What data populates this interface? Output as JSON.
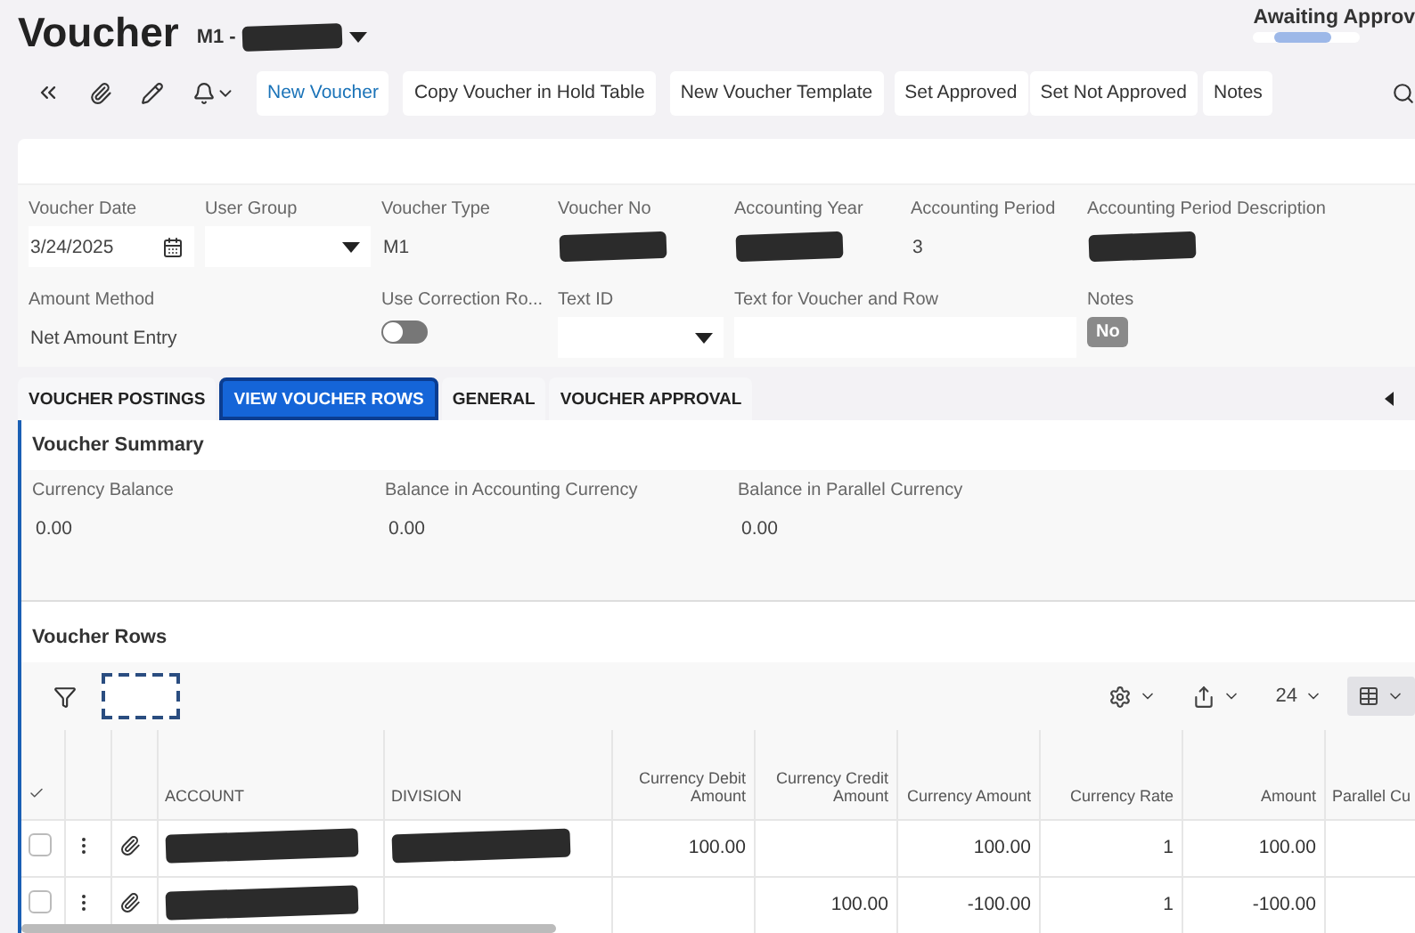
{
  "header": {
    "title": "Voucher",
    "subtitle": "M1 -",
    "status": "Awaiting Approv"
  },
  "toolbar": {
    "buttons": [
      {
        "label": "New Voucher",
        "kind": "primary"
      },
      {
        "label": "Copy Voucher in Hold Table",
        "kind": "plain"
      },
      {
        "label": "New Voucher Template",
        "kind": "plain"
      },
      {
        "label": "Set Approved",
        "kind": "grouped"
      },
      {
        "label": "Set Not Approved",
        "kind": "grouped"
      },
      {
        "label": "Notes",
        "kind": "plain"
      }
    ]
  },
  "field_rows": [
    {
      "fields": [
        {
          "label": "Voucher Date",
          "value": "3/24/2025",
          "kind": "date"
        },
        {
          "label": "User Group",
          "kind": "select"
        },
        {
          "label": "Voucher Type",
          "value": "M1",
          "kind": "text"
        },
        {
          "label": "Voucher No",
          "kind": "redacted"
        },
        {
          "label": "Accounting Year",
          "kind": "redacted"
        },
        {
          "label": "Accounting Period",
          "value": "3",
          "kind": "text"
        },
        {
          "label": "Accounting Period Description",
          "kind": "redacted"
        }
      ]
    },
    {
      "fields": [
        {
          "label": "Amount Method",
          "value": "Net Amount Entry",
          "kind": "text",
          "wide": true
        },
        {
          "label": "Use Correction Ro...",
          "kind": "toggle",
          "on": false
        },
        {
          "label": "Text ID",
          "kind": "select"
        },
        {
          "label": "Text for Voucher and Row",
          "kind": "input",
          "wide": true
        },
        {
          "label": "Notes",
          "value": "No",
          "kind": "badge"
        }
      ]
    }
  ],
  "tabs": [
    {
      "label": "VOUCHER POSTINGS",
      "selected": false
    },
    {
      "label": "VIEW VOUCHER ROWS",
      "selected": true
    },
    {
      "label": "GENERAL",
      "selected": false
    },
    {
      "label": "VOUCHER APPROVAL",
      "selected": false
    }
  ],
  "summary": {
    "title": "Voucher Summary",
    "fields": [
      {
        "label": "Currency Balance",
        "value": "0.00"
      },
      {
        "label": "Balance in Accounting Currency",
        "value": "0.00"
      },
      {
        "label": "Balance in Parallel Currency",
        "value": "0.00"
      }
    ]
  },
  "voucher_rows": {
    "title": "Voucher Rows",
    "page_size": "24",
    "columns": [
      "ACCOUNT",
      "DIVISION",
      "Currency Debit Amount",
      "Currency Credit Amount",
      "Currency Amount",
      "Currency Rate",
      "Amount",
      "Parallel Cu"
    ],
    "rows": [
      {
        "checked": false,
        "cells": [
          {
            "kind": "redacted"
          },
          {
            "kind": "redacted"
          },
          "100.00",
          null,
          "100.00",
          "1",
          "100.00",
          null
        ]
      },
      {
        "checked": false,
        "cells": [
          {
            "kind": "redacted"
          },
          null,
          null,
          "100.00",
          "-100.00",
          "1",
          "-100.00",
          null
        ]
      }
    ]
  }
}
